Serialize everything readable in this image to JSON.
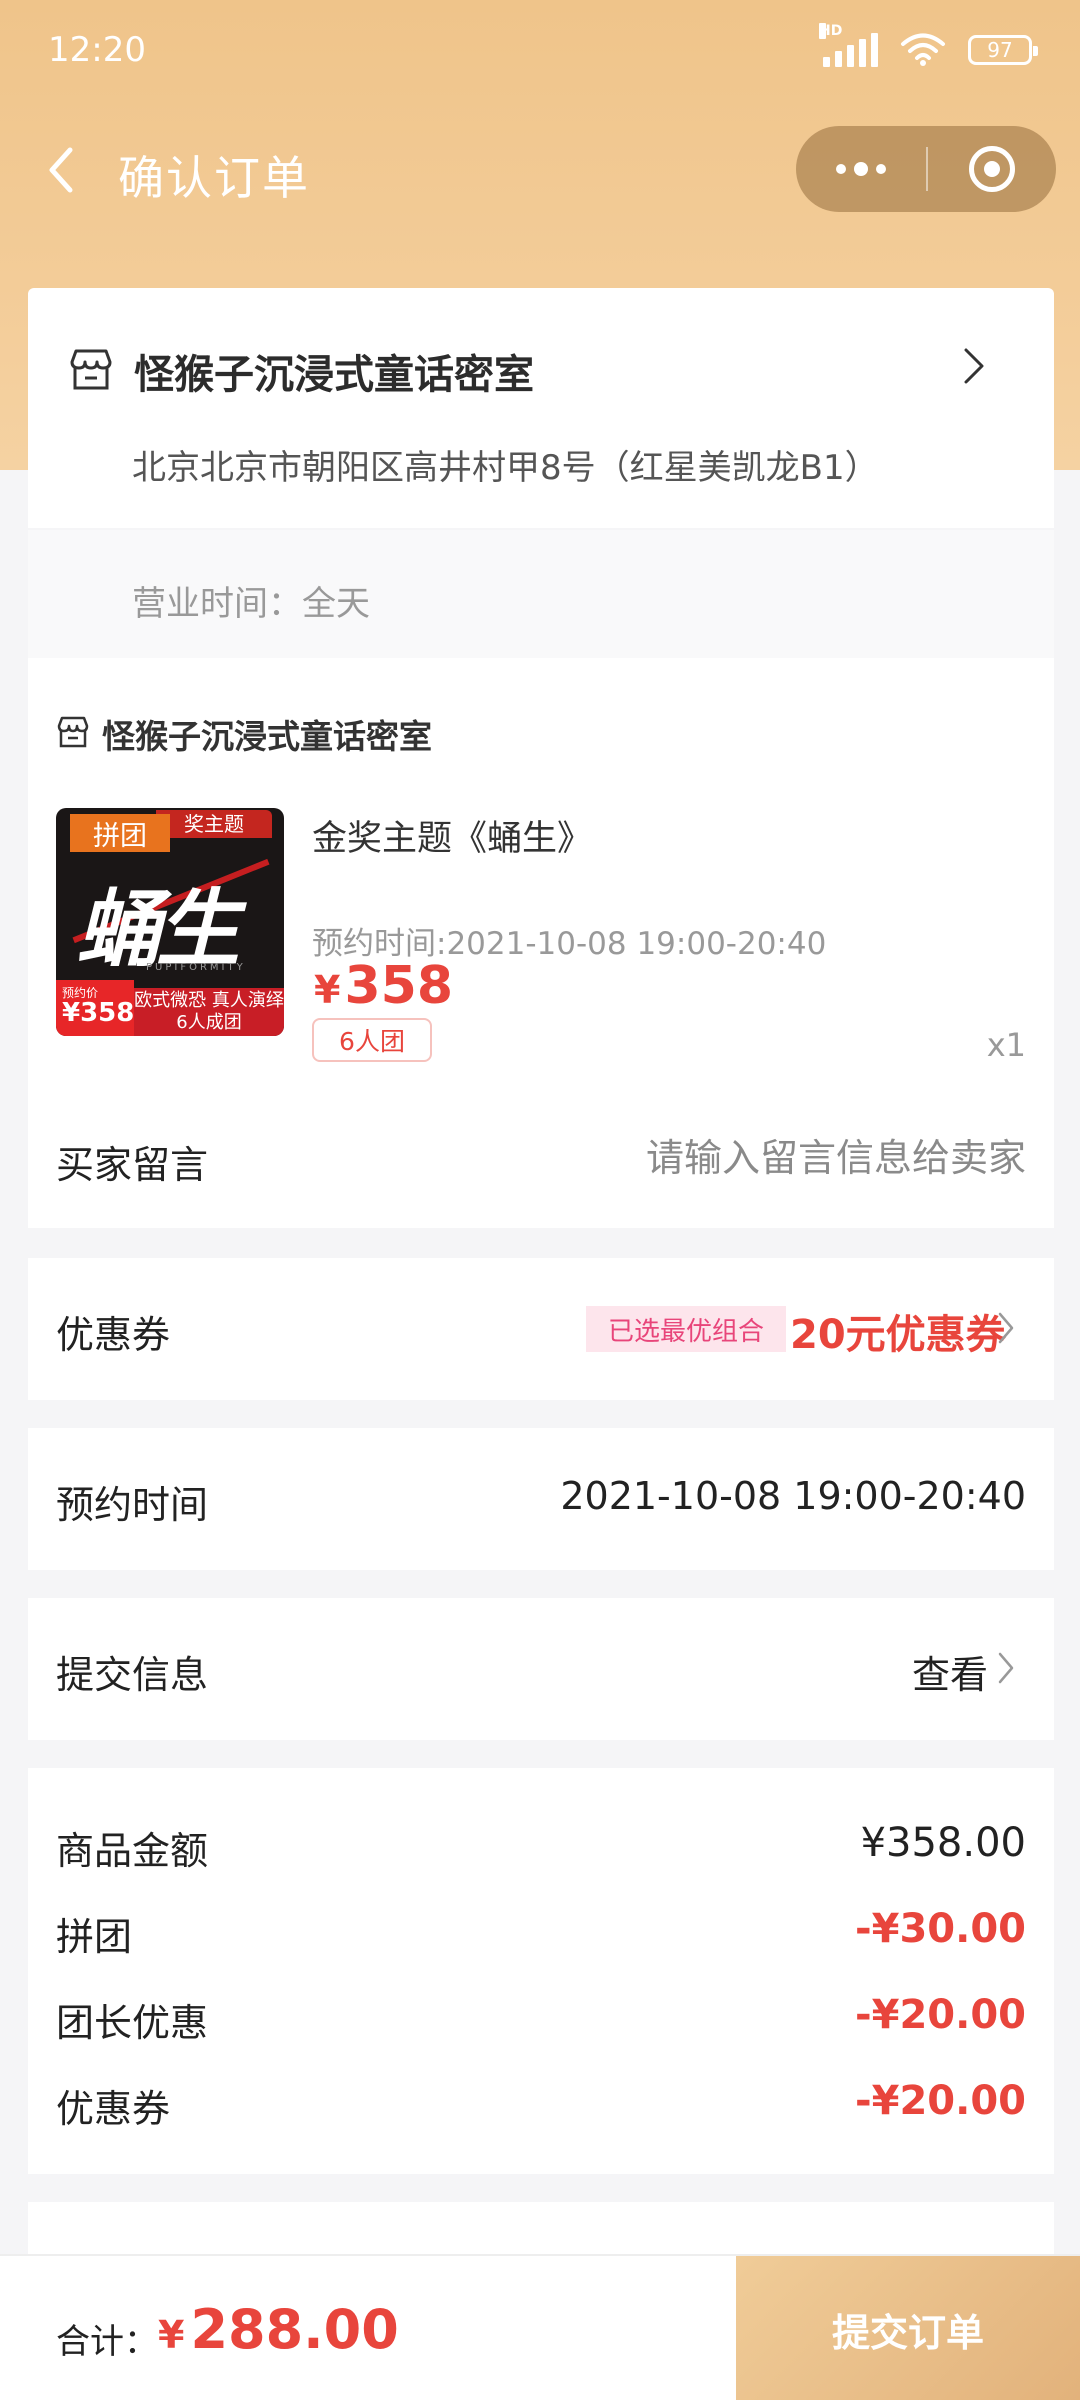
{
  "status_bar": {
    "time": "12:20",
    "network_label": "HD",
    "battery": "97"
  },
  "nav": {
    "title": "确认订单"
  },
  "store": {
    "name": "怪猴子沉浸式童话密室",
    "address": "北京北京市朝阳区高井村甲8号（红星美凯龙B1）",
    "hours": "营业时间：全天"
  },
  "order": {
    "shop_name": "怪猴子沉浸式童话密室",
    "thumb": {
      "tag": "拼团",
      "award": "奖主题",
      "art_title": "蛹生",
      "art_sub": "PUPIFORMITY",
      "price_label": "预约价",
      "price": "¥358",
      "strip_line1": "欧式微恐 真人演绎",
      "strip_line2": "6人成团"
    },
    "item_name": "金奖主题《蛹生》",
    "item_time": "预约时间:2021-10-08 19:00-20:40",
    "price_symbol": "¥",
    "price_value": "358",
    "group_tag": "6人团",
    "quantity": "x1",
    "message_label": "买家留言",
    "message_placeholder": "请输入留言信息给卖家",
    "message_value": ""
  },
  "coupon": {
    "label": "优惠券",
    "badge": "已选最优组合",
    "value": "20元优惠券"
  },
  "reservation": {
    "label": "预约时间",
    "value": "2021-10-08 19:00-20:40"
  },
  "submit_info": {
    "label": "提交信息",
    "action": "查看"
  },
  "summary": {
    "rows": [
      {
        "label": "商品金额",
        "value": "¥358.00"
      },
      {
        "label": "拼团",
        "value": "-¥30.00"
      },
      {
        "label": "团长优惠",
        "value": "-¥20.00"
      },
      {
        "label": "优惠券",
        "value": "-¥20.00"
      }
    ]
  },
  "footer": {
    "total_label": "合计：",
    "total_symbol": "¥",
    "total_value": "288.00",
    "submit_label": "提交订单"
  },
  "colors": {
    "accent": "#e8453c",
    "header": "#efc48a",
    "button": "#e2b27b"
  }
}
